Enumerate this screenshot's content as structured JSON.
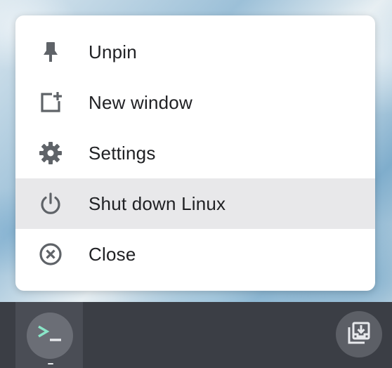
{
  "menu": {
    "items": [
      {
        "label": "Unpin",
        "icon": "pin-icon"
      },
      {
        "label": "New window",
        "icon": "new-window-icon"
      },
      {
        "label": "Settings",
        "icon": "gear-icon"
      },
      {
        "label": "Shut down Linux",
        "icon": "power-icon",
        "highlighted": true
      },
      {
        "label": "Close",
        "icon": "close-circle-icon"
      }
    ]
  },
  "shelf": {
    "app": {
      "name": "Terminal",
      "icon": "terminal-icon"
    },
    "tray": {
      "icon": "holding-space-icon"
    }
  },
  "colors": {
    "menu_bg": "#ffffff",
    "highlight_bg": "#e8e8ea",
    "icon_color": "#5f6368",
    "text_color": "#202124",
    "shelf_bg": "#3b3e45",
    "terminal_prompt": "#8ae6c8"
  }
}
